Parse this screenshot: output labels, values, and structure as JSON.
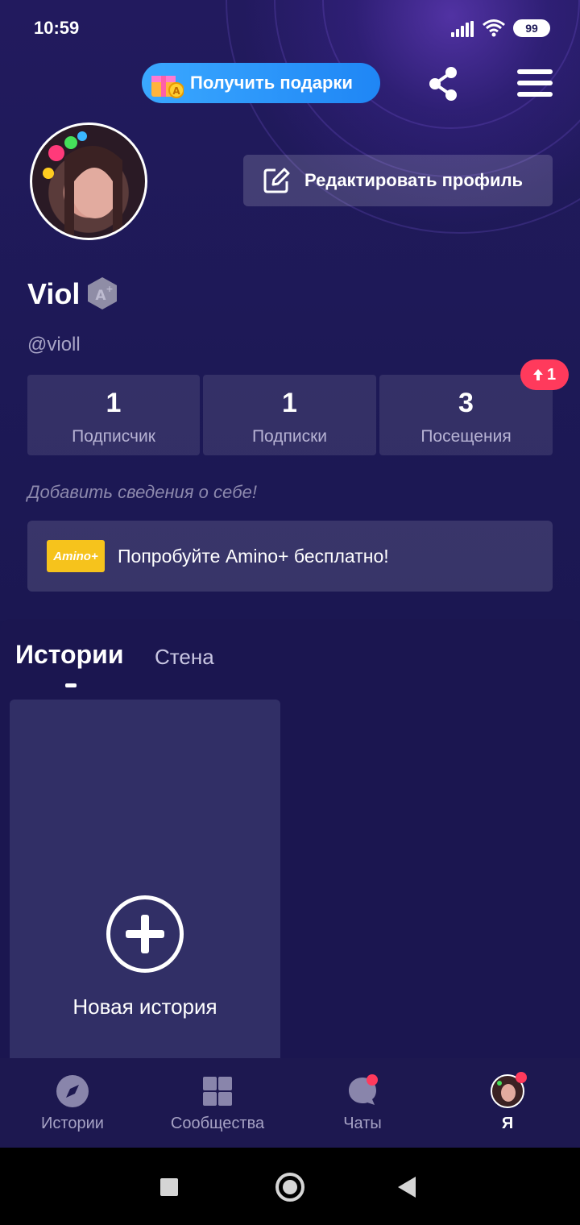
{
  "status_bar": {
    "time": "10:59",
    "battery": "99"
  },
  "header": {
    "gifts_label": "Получить подарки"
  },
  "profile": {
    "edit_label": "Редактировать профиль",
    "name": "Viol",
    "handle": "@violl",
    "bio_prompt": "Добавить сведения о себе!"
  },
  "stats": [
    {
      "value": "1",
      "label": "Подписчик"
    },
    {
      "value": "1",
      "label": "Подписки"
    },
    {
      "value": "3",
      "label": "Посещения"
    }
  ],
  "visits_badge": "1",
  "promo": {
    "logo": "Amino+",
    "text": "Попробуйте Amino+ бесплатно!"
  },
  "tabs": [
    {
      "label": "Истории"
    },
    {
      "label": "Стена"
    }
  ],
  "new_story_label": "Новая история",
  "nav": [
    {
      "label": "Истории",
      "icon": "compass-icon"
    },
    {
      "label": "Сообщества",
      "icon": "grid-icon"
    },
    {
      "label": "Чаты",
      "icon": "chat-bubble-icon"
    },
    {
      "label": "Я",
      "icon": "avatar"
    }
  ],
  "colors": {
    "accent": "#2f98fb",
    "badge": "#ff3a5c",
    "promo_logo": "#f6c31c"
  }
}
